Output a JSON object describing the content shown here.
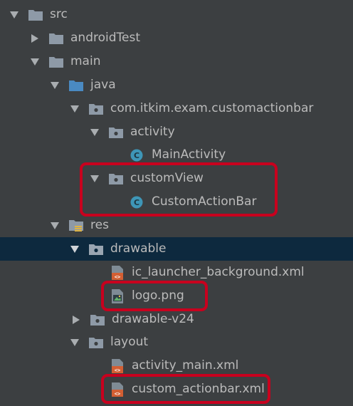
{
  "tree": {
    "items": [
      {
        "label": "src"
      },
      {
        "label": "androidTest"
      },
      {
        "label": "main"
      },
      {
        "label": "java"
      },
      {
        "label": "com.itkim.exam.customactionbar"
      },
      {
        "label": "activity"
      },
      {
        "label": "MainActivity"
      },
      {
        "label": "customView"
      },
      {
        "label": "CustomActionBar"
      },
      {
        "label": "res"
      },
      {
        "label": "drawable"
      },
      {
        "label": "ic_launcher_background.xml"
      },
      {
        "label": "logo.png"
      },
      {
        "label": "drawable-v24"
      },
      {
        "label": "layout"
      },
      {
        "label": "activity_main.xml"
      },
      {
        "label": "custom_actionbar.xml"
      }
    ],
    "selected": "drawable"
  },
  "colors": {
    "background": "#3c3f41",
    "selection": "#0d293e",
    "text": "#bbbbbb",
    "folder": "#8e9aa7",
    "source_folder": "#4a8ac2",
    "class_icon": "#3e96b7",
    "xml_icon": "#d35f33",
    "highlight": "#c8001e"
  },
  "icons": {
    "expanded": "triangle-down-icon",
    "collapsed": "triangle-right-icon",
    "folder": "folder-icon",
    "source_folder": "source-folder-icon",
    "package": "package-icon",
    "class": "class-icon",
    "xml": "xml-file-icon",
    "image": "image-file-icon",
    "resource_folder": "resource-folder-icon"
  }
}
